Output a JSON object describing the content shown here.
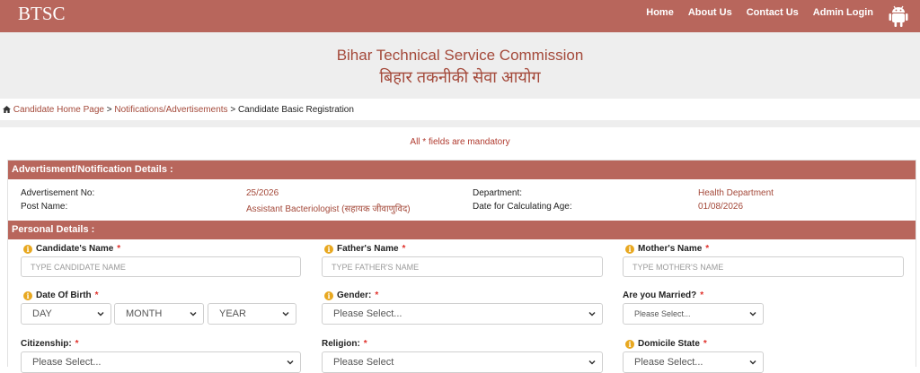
{
  "nav": {
    "brand": "BTSC",
    "links": [
      "Home",
      "About Us",
      "Contact Us",
      "Admin Login"
    ]
  },
  "banner": {
    "title_en": "Bihar Technical Service Commission",
    "title_hi": "बिहार तकनीकी सेवा आयोग"
  },
  "breadcrumb": {
    "home": "Candidate Home Page",
    "sep": ">",
    "notif": "Notifications/Advertisements",
    "current": "Candidate Basic Registration"
  },
  "mandatory_note": "All * fields are mandatory",
  "adv_section": {
    "title": "Advertisment/Notification Details :",
    "adv_no_label": "Advertisement No:",
    "adv_no_value": "25/2026",
    "post_label": "Post Name:",
    "post_value": "Assistant Bacteriologist (सहायक जीवाणुविद)",
    "dept_label": "Department:",
    "dept_value": "Health Department",
    "age_label": "Date for Calculating Age:",
    "age_value": "01/08/2026"
  },
  "personal": {
    "title": "Personal Details :",
    "candidate_name": {
      "label": "Candidate's Name",
      "placeholder": "TYPE CANDIDATE NAME"
    },
    "father_name": {
      "label": "Father's Name",
      "placeholder": "TYPE FATHER'S NAME"
    },
    "mother_name": {
      "label": "Mother's Name",
      "placeholder": "TYPE MOTHER'S NAME"
    },
    "dob": {
      "label": "Date Of Birth",
      "day": "DAY",
      "month": "MONTH",
      "year": "YEAR"
    },
    "gender": {
      "label": "Gender:",
      "value": "Please Select..."
    },
    "married": {
      "label": "Are you Married?",
      "value": "Please Select..."
    },
    "citizenship": {
      "label": "Citizenship:",
      "value": "Please Select..."
    },
    "religion": {
      "label": "Religion:",
      "value": "Please Select"
    },
    "domicile": {
      "label": "Domicile State",
      "value": "Please Select..."
    },
    "required_mark": "*"
  },
  "colors": {
    "accent": "#b8665c",
    "accent_text": "#a4493a",
    "required": "#e0302a",
    "info": "#e8a820"
  },
  "icons": [
    "android-icon",
    "home-icon",
    "info-icon",
    "chevron-down-icon"
  ]
}
